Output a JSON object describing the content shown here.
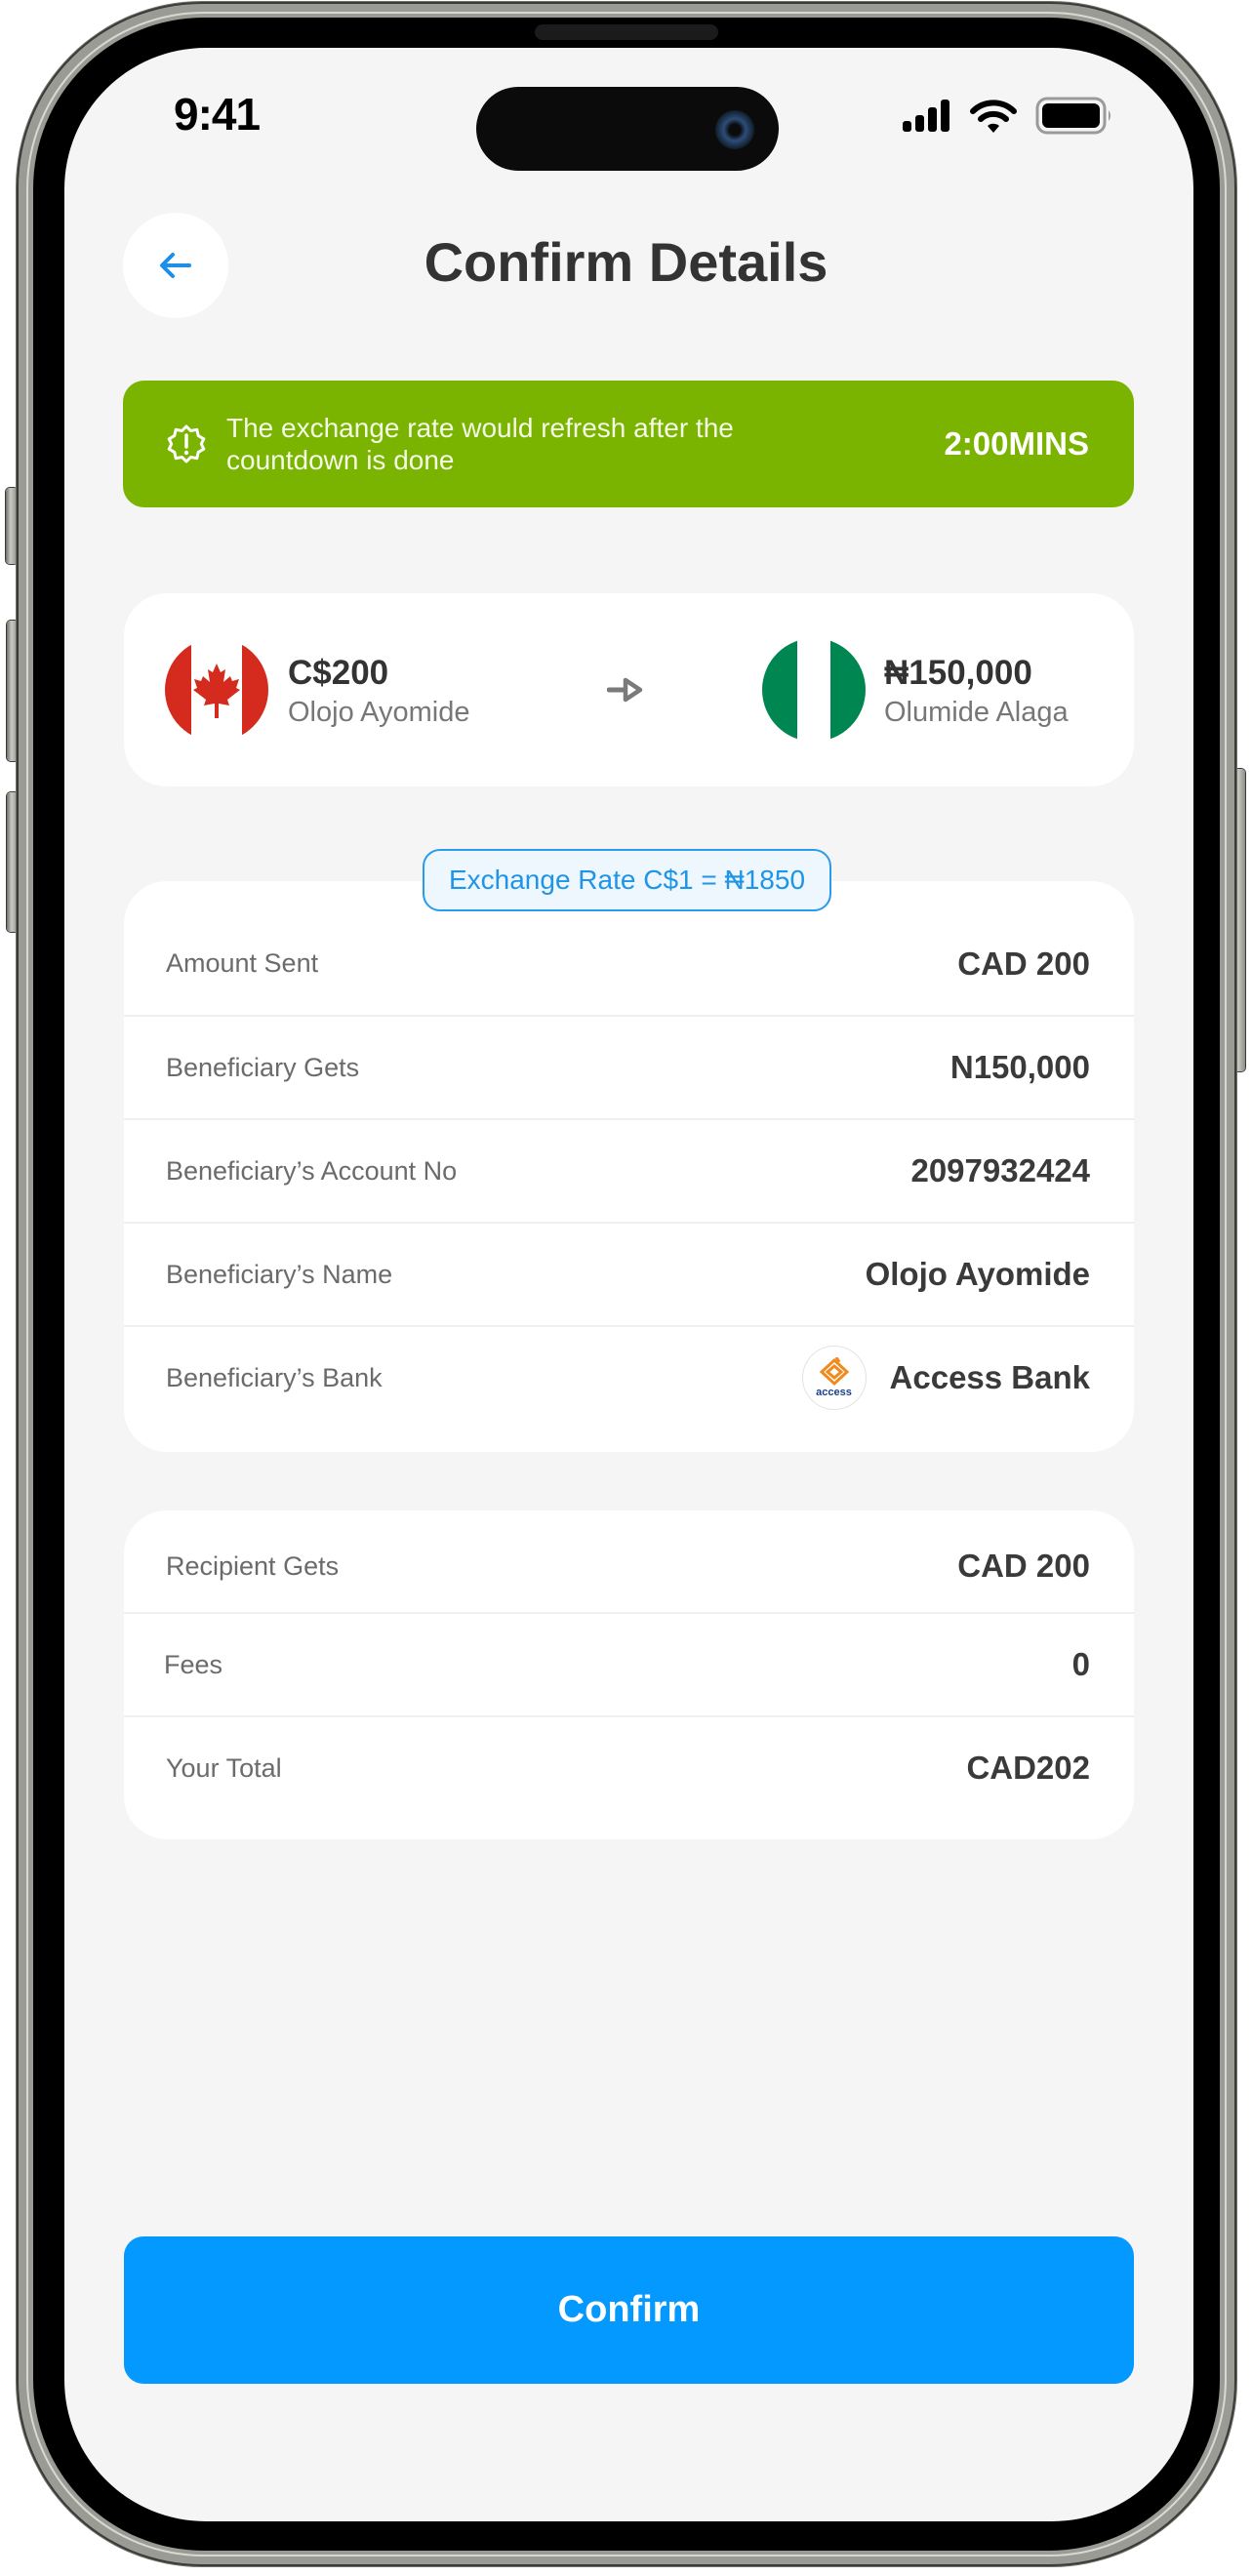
{
  "status_bar": {
    "time": "9:41",
    "icons": [
      "cellular-signal-icon",
      "wifi-icon",
      "battery-icon"
    ]
  },
  "header": {
    "back_icon": "arrow-left-icon",
    "title": "Confirm Details"
  },
  "banner": {
    "icon": "badge-alert-icon",
    "message": "The exchange rate would refresh after the countdown is done",
    "countdown": "2:00MINS",
    "color": "#7AB300"
  },
  "transfer": {
    "sender": {
      "flag": "canada-flag-icon",
      "amount": "C$200",
      "name": "Olojo Ayomide"
    },
    "arrow_icon": "arrow-right-icon",
    "receiver": {
      "flag": "nigeria-flag-icon",
      "amount": "₦150,000",
      "name": "Olumide Alaga"
    }
  },
  "exchange_rate": {
    "label": "Exchange Rate C$1 = ₦1850"
  },
  "details": {
    "rows": [
      {
        "label": "Amount Sent",
        "value": "CAD 200"
      },
      {
        "label": "Beneficiary Gets",
        "value": "N150,000"
      },
      {
        "label": "Beneficiary’s Account No",
        "value": "2097932424"
      },
      {
        "label": "Beneficiary’s Name",
        "value": "Olojo Ayomide"
      },
      {
        "label": "Beneficiary’s Bank",
        "value": "Access Bank",
        "logo": "access-bank-logo",
        "logo_text": "access"
      }
    ]
  },
  "summary": {
    "rows": [
      {
        "label": "Recipient Gets",
        "value": "CAD 200"
      },
      {
        "label": "Fees",
        "value": "0"
      },
      {
        "label": "Your Total",
        "value": "CAD202"
      }
    ]
  },
  "actions": {
    "confirm_label": "Confirm",
    "confirm_color": "#0399FF"
  }
}
